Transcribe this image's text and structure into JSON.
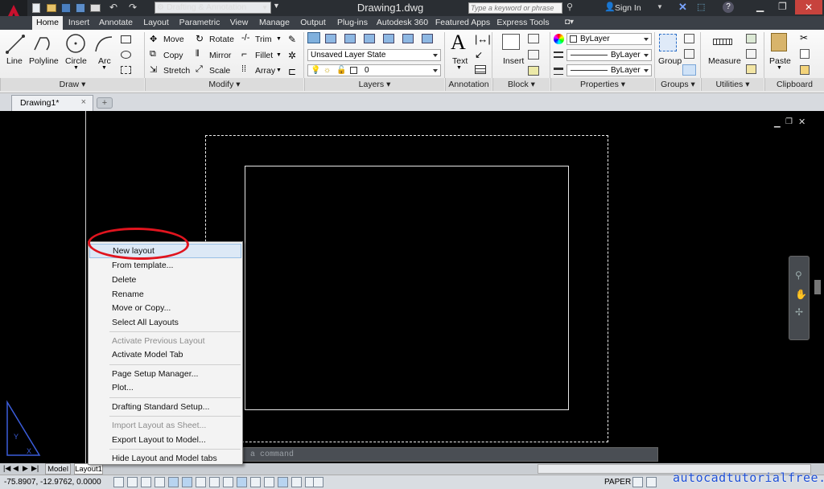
{
  "app": {
    "title": "Drawing1.dwg",
    "workspace": "Drafting & Annotation",
    "search_placeholder": "Type a keyword or phrase",
    "sign_in": "Sign In",
    "logo": "A"
  },
  "ribbon_tabs": [
    "Home",
    "Insert",
    "Annotate",
    "Layout",
    "Parametric",
    "View",
    "Manage",
    "Output",
    "Plug-ins",
    "Autodesk 360",
    "Featured Apps",
    "Express Tools"
  ],
  "draw": {
    "line": "Line",
    "polyline": "Polyline",
    "circle": "Circle",
    "arc": "Arc",
    "title": "Draw"
  },
  "modify": {
    "move": "Move",
    "rotate": "Rotate",
    "trim": "Trim",
    "copy": "Copy",
    "mirror": "Mirror",
    "fillet": "Fillet",
    "stretch": "Stretch",
    "scale": "Scale",
    "array": "Array",
    "title": "Modify"
  },
  "layers": {
    "state": "Unsaved Layer State",
    "current": "0",
    "title": "Layers"
  },
  "annotation": {
    "text": "Text",
    "title": "Annotation"
  },
  "block": {
    "insert": "Insert",
    "title": "Block"
  },
  "properties": {
    "color": "ByLayer",
    "linetype": "ByLayer",
    "lineweight": "ByLayer",
    "title": "Properties"
  },
  "groups": {
    "group": "Group",
    "title": "Groups"
  },
  "utilities": {
    "measure": "Measure",
    "title": "Utilities"
  },
  "clipboard": {
    "paste": "Paste",
    "title": "Clipboard"
  },
  "doc_tab": {
    "name": "Drawing1*",
    "close": "×"
  },
  "command_line": {
    "placeholder": "a command"
  },
  "context_menu": {
    "items": [
      {
        "label": "New layout",
        "enabled": true,
        "highlighted": true
      },
      {
        "label": "From template...",
        "enabled": true
      },
      {
        "label": "Delete",
        "enabled": true
      },
      {
        "label": "Rename",
        "enabled": true
      },
      {
        "label": "Move or Copy...",
        "enabled": true
      },
      {
        "label": "Select All Layouts",
        "enabled": true
      },
      {
        "label": "Activate Previous Layout",
        "enabled": false
      },
      {
        "label": "Activate Model Tab",
        "enabled": true
      },
      {
        "label": "Page Setup Manager...",
        "enabled": true
      },
      {
        "label": "Plot...",
        "enabled": true
      },
      {
        "label": "Drafting Standard Setup...",
        "enabled": true
      },
      {
        "label": "Import Layout as Sheet...",
        "enabled": false
      },
      {
        "label": "Export Layout to Model...",
        "enabled": true
      },
      {
        "label": "Hide Layout and Model tabs",
        "enabled": true
      }
    ]
  },
  "layout_tabs": {
    "model": "Model",
    "layout1": "Layout1"
  },
  "status": {
    "coords": "-75.8907, -12.9762, 0.0000",
    "paper": "PAPER"
  },
  "watermark": "autocadtutorialfree.com",
  "colors": {
    "accent": "#c8102e",
    "highlight_circle": "#e0141e",
    "selection": "#dde9f6"
  }
}
